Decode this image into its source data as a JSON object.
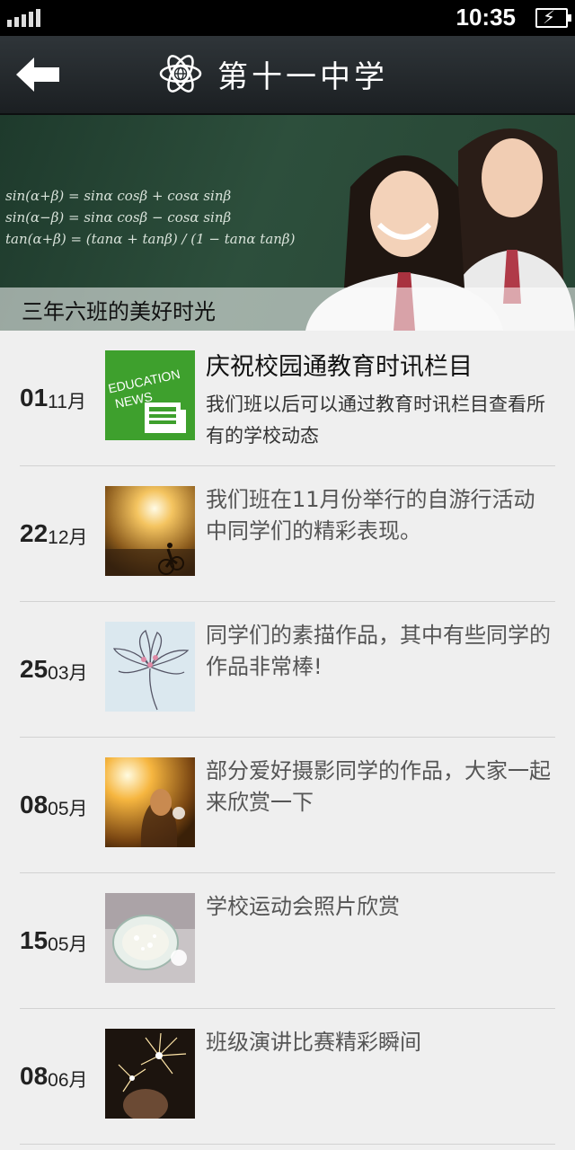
{
  "status_bar": {
    "time": "10:35"
  },
  "header": {
    "title": "第十一中学"
  },
  "banner": {
    "caption": "三年六班的美好时光",
    "chalk_lines": [
      "sin(α+β) = sinα cosβ + cosα sinβ",
      "sin(α−β) = sinα cosβ − cosα sinβ",
      "tan(α+β) = (tanα + tanβ) / (1 − tanα tanβ)"
    ]
  },
  "thumb_badge": {
    "line1": "EDUCATION",
    "line2": "NEWS"
  },
  "news": [
    {
      "day": "01",
      "month": "11月",
      "title": "庆祝校园通教育时讯栏目",
      "text": "我们班以后可以通过教育时讯栏目查看所有的学校动态",
      "thumb": "education-news"
    },
    {
      "day": "22",
      "month": "12月",
      "title": "",
      "text": "我们班在11月份举行的自游行活动中同学们的精彩表现。",
      "thumb": "cyclist-sunset"
    },
    {
      "day": "25",
      "month": "03月",
      "title": "",
      "text": "同学们的素描作品，其中有些同学的作品非常棒!",
      "thumb": "lotus-sketch"
    },
    {
      "day": "08",
      "month": "05月",
      "title": "",
      "text": "部分爱好摄影同学的作品，大家一起来欣赏一下",
      "thumb": "girl-sunlight"
    },
    {
      "day": "15",
      "month": "05月",
      "title": "",
      "text": "学校运动会照片欣赏",
      "thumb": "dandelion-jar"
    },
    {
      "day": "08",
      "month": "06月",
      "title": "",
      "text": "班级演讲比赛精彩瞬间",
      "thumb": "sparkler"
    }
  ]
}
